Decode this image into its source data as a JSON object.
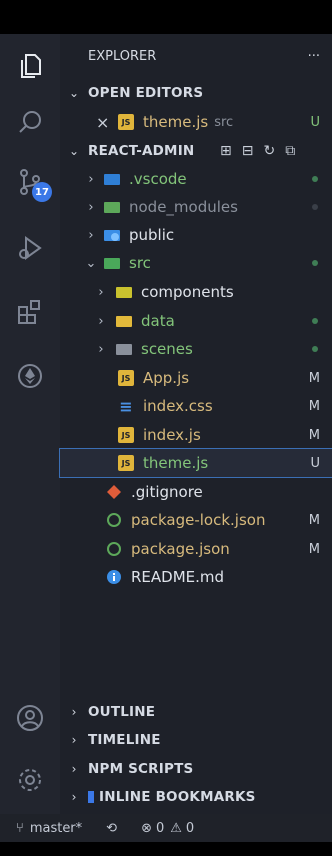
{
  "explorer": {
    "title": "EXPLORER",
    "more": "···",
    "open_editors": {
      "label": "OPEN EDITORS",
      "items": [
        {
          "close": "×",
          "name": "theme.js",
          "folder": "src",
          "status": "U"
        }
      ]
    },
    "project": {
      "label": "REACT-ADMIN",
      "actions": [
        "new-file-icon",
        "new-folder-icon",
        "refresh-icon",
        "collapse-all-icon"
      ]
    },
    "tree": [
      {
        "name": ".vscode",
        "status": "",
        "dot": true
      },
      {
        "name": "node_modules",
        "status": "",
        "dot": true
      },
      {
        "name": "public",
        "status": "",
        "dot": false
      },
      {
        "name": "src",
        "status": "",
        "dot": true
      },
      {
        "name": "components",
        "status": "",
        "dot": false
      },
      {
        "name": "data",
        "status": "",
        "dot": true
      },
      {
        "name": "scenes",
        "status": "",
        "dot": true
      },
      {
        "name": "App.js",
        "status": "M"
      },
      {
        "name": "index.css",
        "status": "M"
      },
      {
        "name": "index.js",
        "status": "M"
      },
      {
        "name": "theme.js",
        "status": "U"
      },
      {
        "name": ".gitignore",
        "status": ""
      },
      {
        "name": "package-lock.json",
        "status": "M"
      },
      {
        "name": "package.json",
        "status": "M"
      },
      {
        "name": "README.md",
        "status": ""
      }
    ],
    "panels": [
      "OUTLINE",
      "TIMELINE",
      "NPM SCRIPTS",
      "INLINE BOOKMARKS"
    ]
  },
  "activity": {
    "scm_badge": "17"
  },
  "status": {
    "branch": "master*",
    "errors": "0",
    "warnings": "0"
  },
  "colors": {
    "accent": "#3b78e7",
    "modified": "#d7ba7d",
    "untracked": "#83c47a"
  }
}
